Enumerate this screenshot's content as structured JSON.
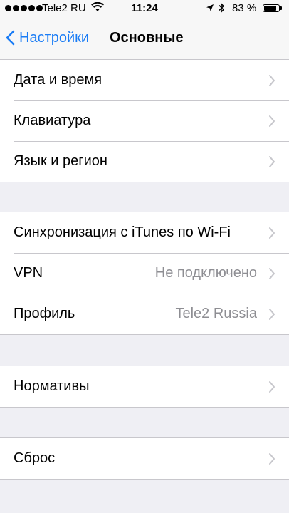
{
  "status_bar": {
    "carrier": "Tele2 RU",
    "time": "11:24",
    "battery_text": "83 %",
    "battery_level": 0.83,
    "icons": [
      "signal-dots",
      "wifi-icon",
      "location-arrow-icon",
      "bluetooth-icon",
      "battery-icon"
    ]
  },
  "nav": {
    "back_label": "Настройки",
    "title": "Основные",
    "accent_color": "#1a7cf5"
  },
  "groups": [
    {
      "items": [
        {
          "label": "Дата и время",
          "value": ""
        },
        {
          "label": "Клавиатура",
          "value": ""
        },
        {
          "label": "Язык и регион",
          "value": ""
        }
      ]
    },
    {
      "items": [
        {
          "label": "Синхронизация с iTunes по Wi-Fi",
          "value": ""
        },
        {
          "label": "VPN",
          "value": "Не подключено"
        },
        {
          "label": "Профиль",
          "value": "Tele2 Russia"
        }
      ]
    },
    {
      "items": [
        {
          "label": "Нормативы",
          "value": ""
        }
      ]
    },
    {
      "items": [
        {
          "label": "Сброс",
          "value": ""
        }
      ]
    }
  ]
}
